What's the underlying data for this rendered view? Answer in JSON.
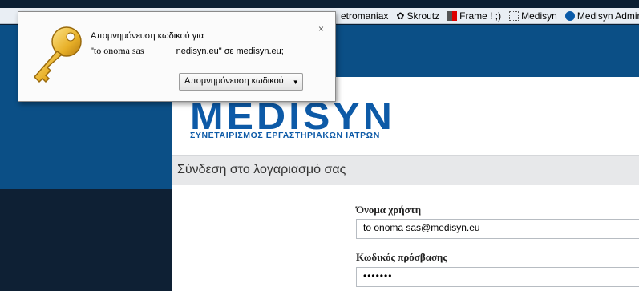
{
  "bookmarks": [
    {
      "label": "etromaniax",
      "icon": "page-icon"
    },
    {
      "label": "Skroutz",
      "icon": "skroutz-icon"
    },
    {
      "label": "Frame ! ;)",
      "icon": "frame-icon"
    },
    {
      "label": "Medisyn",
      "icon": "blank-page-icon"
    },
    {
      "label": "Medisyn Admin",
      "icon": "globe-icon"
    }
  ],
  "popup": {
    "line1": "Απομνημόνευση κωδικού για",
    "line2_prefix": "\"",
    "username": "to onoma sas",
    "line2_suffix": "nedisyn.eu\" σε medisyn.eu;",
    "button_label": "Απομνημόνευση κωδικού",
    "close_glyph": "×"
  },
  "site": {
    "logo_text": "MEDISYN",
    "tagline": "ΣΥΝΕΤΑΙΡΙΣΜΟΣ ΕΡΓΑΣΤΗΡΙΑΚΩΝ ΙΑΤΡΩΝ",
    "heading": "Σύνδεση στο λογαριασμό σας",
    "username_label": "Όνομα χρήστη",
    "username_value": "to onoma sas@medisyn.eu",
    "password_label": "Κωδικός πρόσβασης",
    "password_value": "•••••••"
  },
  "colors": {
    "brand_blue": "#0d5aa7",
    "header_blue": "#0b4f86",
    "dark_navy": "#0e2034"
  }
}
